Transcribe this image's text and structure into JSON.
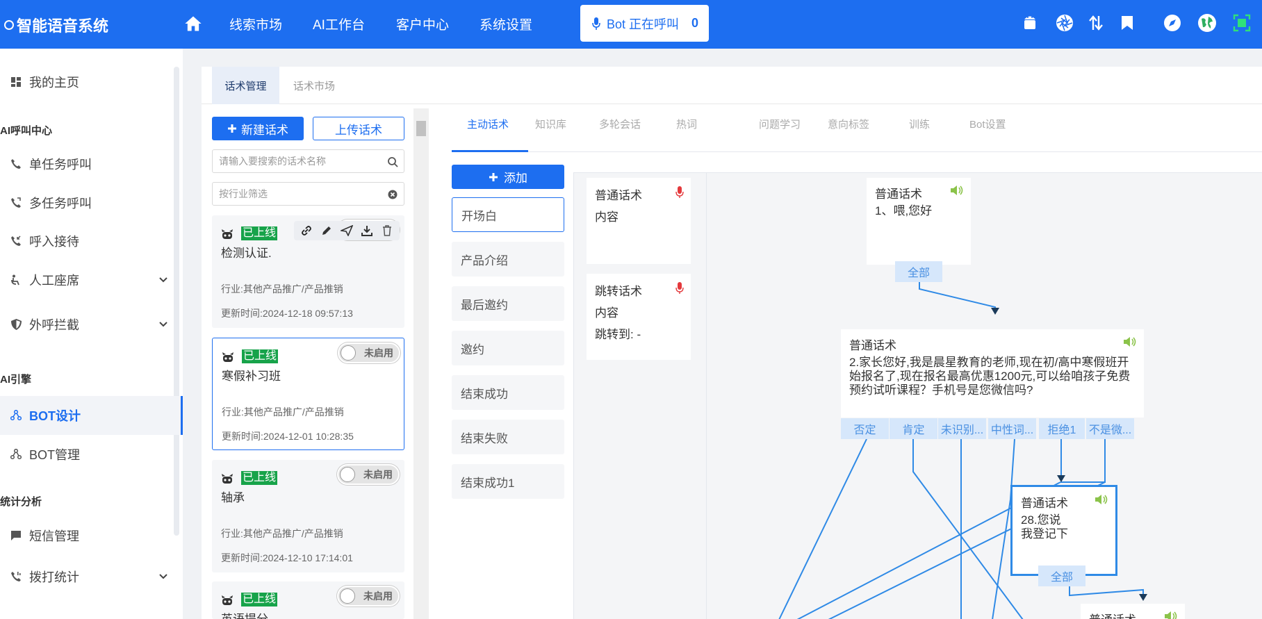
{
  "app": {
    "title": "智能语音系统",
    "nav": [
      "线索市场",
      "AI工作台",
      "客户中心",
      "系统设置"
    ],
    "calling_label": "Bot 正在呼叫",
    "calling_count": "0",
    "accent": "#1d6ef0",
    "top_icons": [
      "android-icon",
      "aperture-icon",
      "transfer-icon",
      "bookmark-icon",
      "compass-icon",
      "globe-icon",
      "fullscreen-icon"
    ]
  },
  "sidebar": {
    "items": [
      {
        "label": "我的主页",
        "icon": "dashboard-icon"
      },
      {
        "label": "单任务呼叫",
        "icon": "phone-icon"
      },
      {
        "label": "多任务呼叫",
        "icon": "phone-multi-icon"
      },
      {
        "label": "呼入接待",
        "icon": "phone-incoming-icon"
      },
      {
        "label": "人工座席",
        "icon": "seat-icon"
      },
      {
        "label": "外呼拦截",
        "icon": "shield-icon"
      },
      {
        "label": "BOT设计",
        "icon": "graph-icon"
      },
      {
        "label": "BOT管理",
        "icon": "graph-icon"
      },
      {
        "label": "短信管理",
        "icon": "message-icon"
      },
      {
        "label": "拨打统计",
        "icon": "phone-stats-icon"
      }
    ],
    "sections": [
      "AI呼叫中心",
      "AI引擎",
      "统计分析"
    ]
  },
  "main": {
    "tabs": [
      "话术管理",
      "话术市场"
    ],
    "new_button": "新建话术",
    "upload_button": "上传话术",
    "search_placeholder": "请输入要搜索的话术名称",
    "filter_placeholder": "按行业筛选",
    "cards": [
      {
        "status": "已上线",
        "name": "检测认证.",
        "industry": "行业:其他产品推广/产品推销",
        "updated": "更新时间:2024-12-18 09:57:13",
        "toggle": ""
      },
      {
        "status": "已上线",
        "name": "寒假补习班",
        "industry": "行业:其他产品推广/产品推销",
        "updated": "更新时间:2024-12-01 10:28:35",
        "toggle": "未启用"
      },
      {
        "status": "已上线",
        "name": "轴承",
        "industry": "行业:其他产品推广/产品推销",
        "updated": "更新时间:2024-12-10 17:14:01",
        "toggle": "未启用"
      },
      {
        "status": "已上线",
        "name": "英语提分",
        "toggle": "未启用"
      }
    ]
  },
  "designer": {
    "sub_tabs": [
      "主动话术",
      "知识库",
      "多轮会话",
      "热词",
      "问题学习",
      "意向标签",
      "训练",
      "Bot设置"
    ],
    "add_button": "添加",
    "flows": [
      "开场白",
      "产品介绍",
      "最后邀约",
      "邀约",
      "结束成功",
      "结束失败",
      "结束成功1"
    ],
    "templates": [
      {
        "lines": [
          "普通话术",
          "内容"
        ]
      },
      {
        "lines": [
          "跳转话术",
          "内容",
          "跳转到: -"
        ]
      }
    ],
    "nodes": {
      "n1": {
        "title": "普通话术",
        "content": "1、喂,您好",
        "branches": [
          "全部"
        ]
      },
      "n2": {
        "title": "普通话术",
        "content": "2.家长您好,我是晨星教育的老师,现在初/高中寒假班开始报名了,现在报名最高优惠1200元,可以给咱孩子免费预约试听课程？手机号是您微信吗?",
        "branches": [
          "否定",
          "肯定",
          "未识别...",
          "中性词...",
          "拒绝1",
          "不是微..."
        ]
      },
      "n3": {
        "title": "普通话术",
        "content": "28.您说\n我登记下",
        "branches": [
          "全部"
        ]
      },
      "n4": {
        "title": "普通话术"
      }
    }
  }
}
